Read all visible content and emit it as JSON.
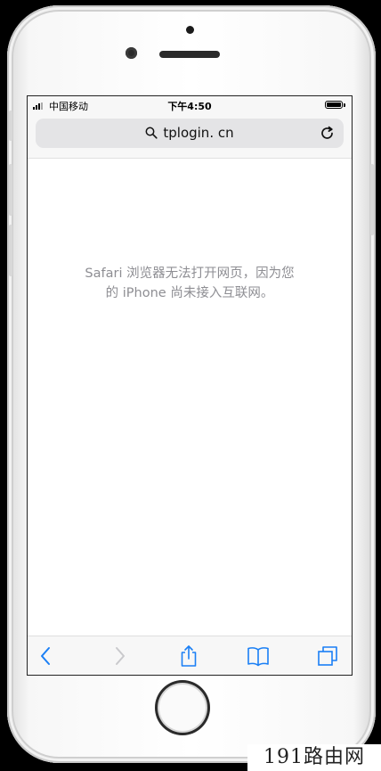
{
  "statusbar": {
    "carrier": "中国移动",
    "time": "下午4:50"
  },
  "navbar": {
    "url": "tplogin. cn"
  },
  "content": {
    "message_line1": "Safari 浏览器无法打开网页，因为您",
    "message_line2": "的 iPhone 尚未接入互联网。"
  },
  "toolbar": {
    "icons": [
      "back-icon",
      "forward-icon",
      "share-icon",
      "bookmarks-icon",
      "tabs-icon"
    ],
    "accent": "#1a7ff5"
  },
  "watermark": "191路由网"
}
